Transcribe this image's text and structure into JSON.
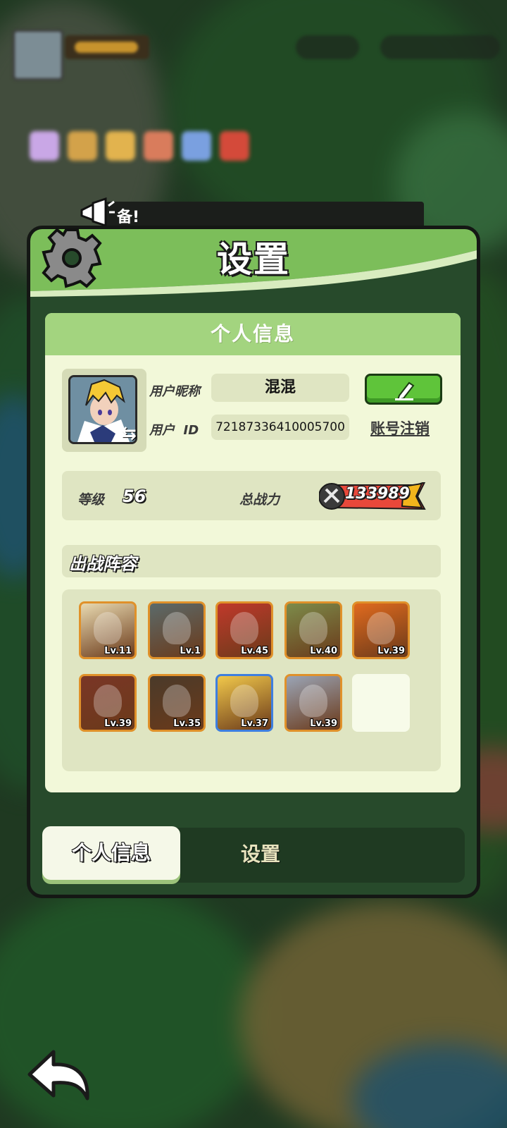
{
  "notice": {
    "text": "备!"
  },
  "dialog": {
    "title": "设置"
  },
  "profile": {
    "section_title": "个人信息",
    "nickname_label": "用户昵称",
    "nickname_value": "混混",
    "id_label": "用户  ID",
    "id_value": "72187336410005700",
    "cancel_account": "账号注销",
    "level_label": "等级",
    "level_value": "56",
    "power_label": "总战力",
    "power_value": "133989"
  },
  "lineup": {
    "title": "出战阵容",
    "heroes": [
      {
        "level": "Lv.11",
        "color": "#e8d9b0"
      },
      {
        "level": "Lv.1",
        "color": "#5b6a6a"
      },
      {
        "level": "Lv.45",
        "color": "#c0392b"
      },
      {
        "level": "Lv.40",
        "color": "#7c8b4a"
      },
      {
        "level": "Lv.39",
        "color": "#e06a1e"
      },
      {
        "level": "Lv.39",
        "color": "#7a3626"
      },
      {
        "level": "Lv.35",
        "color": "#4a3a2a"
      },
      {
        "level": "Lv.37",
        "color": "#f1c84b"
      },
      {
        "level": "Lv.39",
        "color": "#9aa4b5"
      }
    ]
  },
  "tabs": [
    {
      "label": "个人信息",
      "active": true
    },
    {
      "label": "设置",
      "active": false
    }
  ],
  "colors": {
    "panel_green": "#a3d47f",
    "card_bg": "#f2f8d9",
    "edit_button": "#5fc43a",
    "hero_border_gold": "#e0912a",
    "hero_border_blue": "#3e7fe0"
  }
}
